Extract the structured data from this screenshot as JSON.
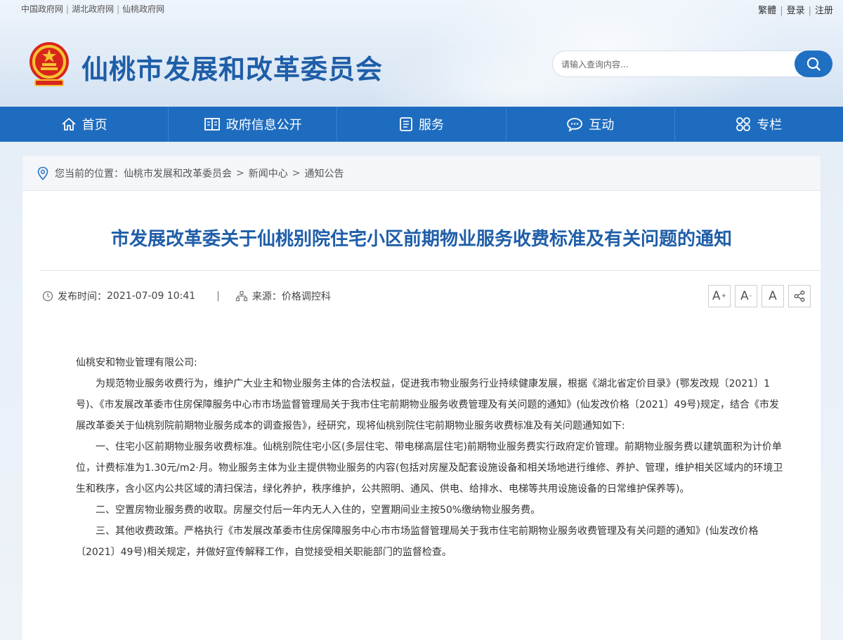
{
  "top_links": [
    "中国政府网",
    "湖北政府网",
    "仙桃政府网"
  ],
  "top_right": [
    "繁體",
    "登录",
    "注册"
  ],
  "site_title": "仙桃市发展和改革委员会",
  "search": {
    "placeholder": "请输入查询内容..."
  },
  "nav": [
    {
      "label": "首页",
      "icon": "home-icon"
    },
    {
      "label": "政府信息公开",
      "icon": "book-icon"
    },
    {
      "label": "服务",
      "icon": "list-icon"
    },
    {
      "label": "互动",
      "icon": "chat-icon"
    },
    {
      "label": "专栏",
      "icon": "grid-icon"
    }
  ],
  "breadcrumb": {
    "prefix": "您当前的位置：",
    "items": [
      "仙桃市发展和改革委员会",
      "新闻中心",
      "通知公告"
    ],
    "separator": ">"
  },
  "article": {
    "title": "市发展改革委关于仙桃别院住宅小区前期物业服务收费标准及有关问题的通知",
    "publish_label": "发布时间：",
    "publish_time": "2021-07-09 10:41",
    "source_label": "来源：",
    "source": "价格调控科",
    "tools": [
      "A",
      "A",
      "A"
    ],
    "paragraphs": [
      "仙桃安和物业管理有限公司:",
      "为规范物业服务收费行为，维护广大业主和物业服务主体的合法权益，促进我市物业服务行业持续健康发展，根据《湖北省定价目录》(鄂发改规〔2021〕1号)、《市发展改革委市住房保障服务中心市市场监督管理局关于我市住宅前期物业服务收费管理及有关问题的通知》(仙发改价格〔2021〕49号)规定，结合《市发展改革委关于仙桃别院前期物业服务成本的调查报告》，经研究，现将仙桃别院住宅前期物业服务收费标准及有关问题通知如下:",
      "一、住宅小区前期物业服务收费标准。仙桃别院住宅小区(多层住宅、带电梯高层住宅)前期物业服务费实行政府定价管理。前期物业服务费以建筑面积为计价单位，计费标准为1.30元/m2·月。物业服务主体为业主提供物业服务的内容(包括对房屋及配套设施设备和相关场地进行维修、养护、管理，维护相关区域内的环境卫生和秩序，含小区内公共区域的清扫保洁，绿化养护，秩序维护，公共照明、通风、供电、给排水、电梯等共用设施设备的日常维护保养等)。",
      "二、空置房物业服务费的收取。房屋交付后一年内无人入住的，空置期间业主按50%缴纳物业服务费。",
      "三、其他收费政策。严格执行《市发展改革委市住房保障服务中心市市场监督管理局关于我市住宅前期物业服务收费管理及有关问题的通知》(仙发改价格〔2021〕49号)相关规定，并做好宣传解释工作，自觉接受相关职能部门的监督检查。"
    ]
  },
  "colors": {
    "brand_blue": "#1e6cbf",
    "title_blue": "#1f5ea8"
  }
}
